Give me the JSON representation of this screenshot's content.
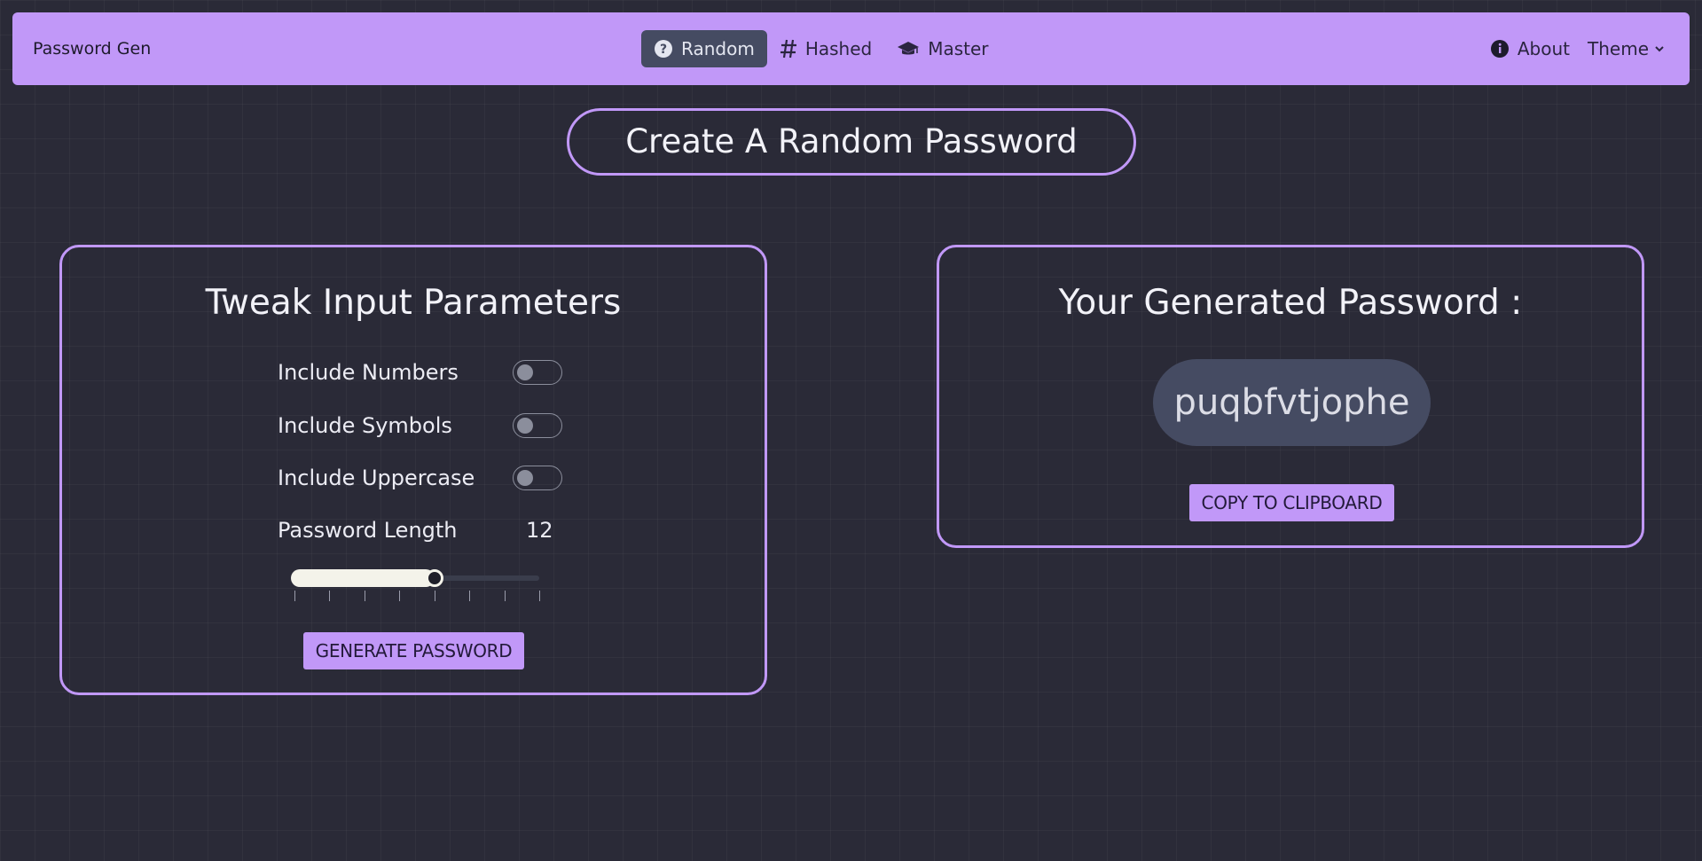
{
  "navbar": {
    "brand": "Password Gen",
    "tabs": [
      {
        "label": "Random",
        "icon": "question-circle-icon",
        "active": true
      },
      {
        "label": "Hashed",
        "icon": "hash-icon",
        "active": false
      },
      {
        "label": "Master",
        "icon": "graduation-cap-icon",
        "active": false
      }
    ],
    "about_label": "About",
    "theme_label": "Theme"
  },
  "page_title": "Create A Random Password",
  "params": {
    "title": "Tweak Input Parameters",
    "options": [
      {
        "label": "Include Numbers",
        "on": false
      },
      {
        "label": "Include Symbols",
        "on": false
      },
      {
        "label": "Include Uppercase",
        "on": false
      }
    ],
    "length_label": "Password Length",
    "length_value": "12",
    "slider": {
      "min": 4,
      "max": 18,
      "step": 2,
      "value": 12
    },
    "generate_label": "GENERATE PASSWORD"
  },
  "result": {
    "title": "Your Generated Password :",
    "password": "puqbfvtjophe",
    "copy_label": "COPY TO CLIPBOARD"
  },
  "colors": {
    "accent": "#c198f8",
    "background": "#2a2a37",
    "pill": "#454b62"
  }
}
